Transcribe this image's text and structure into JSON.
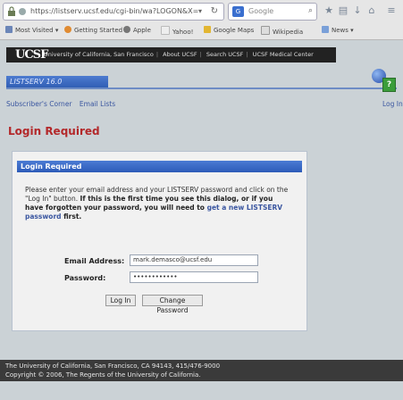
{
  "browser": {
    "url": "https://listserv.ucsf.edu/cgi-bin/wa?LOGON&X=",
    "search_engine": "Google",
    "search_placeholder": "Google",
    "bookmarks": [
      {
        "label": "Most Visited",
        "icon": "bookmark-icon"
      },
      {
        "label": "Getting Started",
        "icon": "firefox-icon"
      },
      {
        "label": "Apple",
        "icon": "apple-icon"
      },
      {
        "label": "Yahoo!",
        "icon": "yahoo-icon"
      },
      {
        "label": "Google Maps",
        "icon": "map-icon"
      },
      {
        "label": "Wikipedia",
        "icon": "wikipedia-icon"
      },
      {
        "label": "News",
        "icon": "news-icon"
      }
    ]
  },
  "site": {
    "logo": "UCSF",
    "nav_links": [
      "University of California, San Francisco",
      "About UCSF",
      "Search UCSF",
      "UCSF Medical Center"
    ],
    "listserv_label": "LISTSERV 16.0",
    "help_badge": "?",
    "subnav": [
      "Subscriber's Corner",
      "Email Lists"
    ],
    "login_link": "Log In"
  },
  "page": {
    "title": "Login Required"
  },
  "dialog": {
    "header": "Login Required",
    "intro_plain": "Please enter your email address and your LISTSERV password and click on the \"Log In\" button. ",
    "intro_bold": "If this is the first time you see this dialog, or if you have forgotten your password, you will need to ",
    "intro_link": "get a new LISTSERV password",
    "intro_end": " first.",
    "email_label": "Email Address:",
    "email_value": "mark.demasco@ucsf.edu",
    "password_label": "Password:",
    "password_value": "••••••••••••",
    "login_button": "Log In",
    "change_password_button": "Change Password"
  },
  "footer": {
    "line1": "The University of California, San Francisco, CA 94143, 415/476-9000",
    "line2": "Copyright © 2006, The Regents of the University of California."
  },
  "colors": {
    "accent_blue": "#2f5cb2",
    "title_red": "#b3282a",
    "link_blue": "#3a56a0"
  }
}
